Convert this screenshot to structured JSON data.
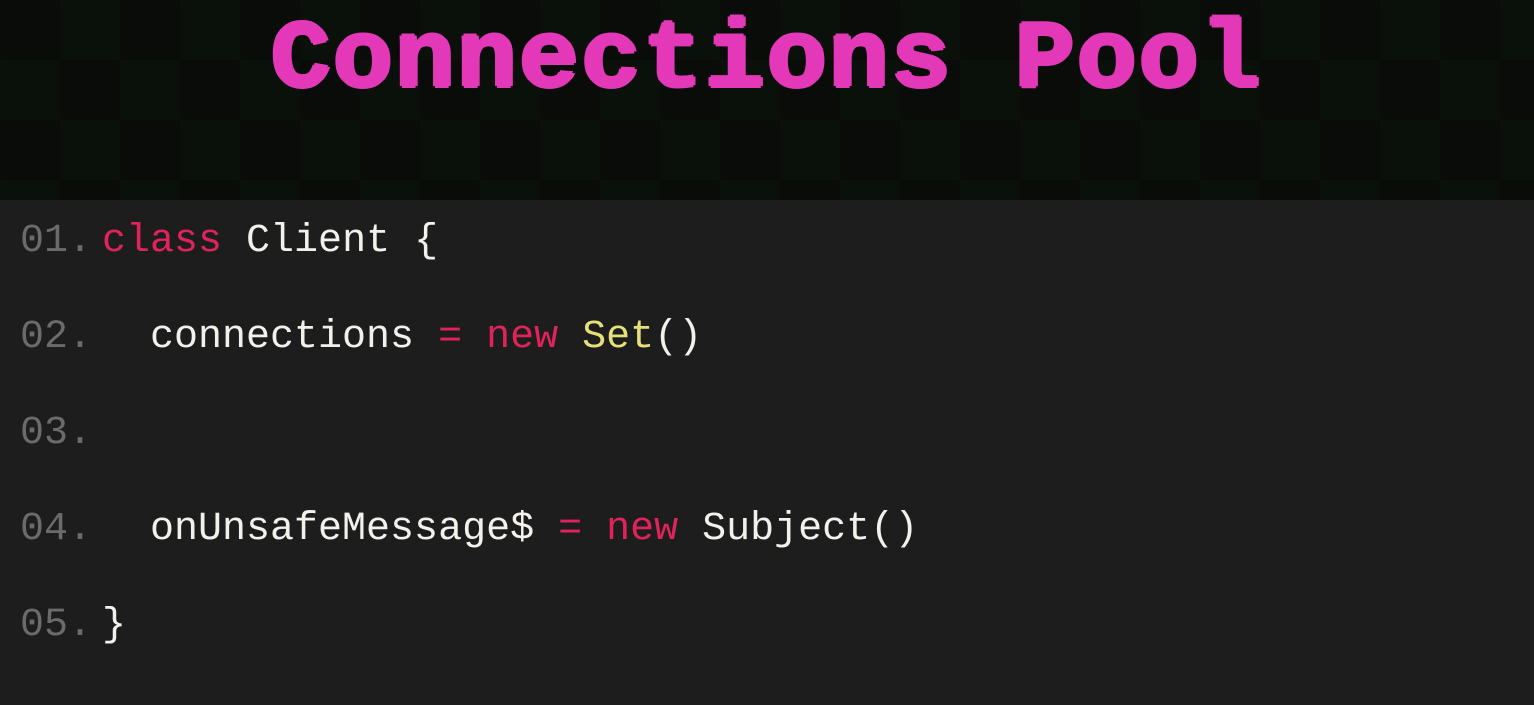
{
  "title": "Connections Pool",
  "colors": {
    "title": "#e339b8",
    "keyword": "#e0245b",
    "type": "#e7e07a",
    "text": "#f2f1ec",
    "line_number": "#6b6b6b",
    "panel_bg": "#1d1d1d",
    "page_bg": "#0a0d0a"
  },
  "code": {
    "lines": [
      {
        "n": "01.",
        "indent": 0,
        "tokens": [
          {
            "t": "class",
            "k": "keyword"
          },
          {
            "t": " ",
            "k": "plain"
          },
          {
            "t": "Client",
            "k": "ident"
          },
          {
            "t": " ",
            "k": "plain"
          },
          {
            "t": "{",
            "k": "punct"
          }
        ]
      },
      {
        "n": "02.",
        "indent": 1,
        "tokens": [
          {
            "t": "connections",
            "k": "ident"
          },
          {
            "t": " ",
            "k": "plain"
          },
          {
            "t": "=",
            "k": "op"
          },
          {
            "t": " ",
            "k": "plain"
          },
          {
            "t": "new",
            "k": "keyword"
          },
          {
            "t": " ",
            "k": "plain"
          },
          {
            "t": "Set",
            "k": "type"
          },
          {
            "t": "()",
            "k": "punct"
          }
        ]
      },
      {
        "n": "03.",
        "indent": 0,
        "tokens": []
      },
      {
        "n": "04.",
        "indent": 1,
        "tokens": [
          {
            "t": "onUnsafeMessage$",
            "k": "ident"
          },
          {
            "t": " ",
            "k": "plain"
          },
          {
            "t": "=",
            "k": "op"
          },
          {
            "t": " ",
            "k": "plain"
          },
          {
            "t": "new",
            "k": "keyword"
          },
          {
            "t": " ",
            "k": "plain"
          },
          {
            "t": "Subject",
            "k": "ident"
          },
          {
            "t": "()",
            "k": "punct"
          }
        ]
      },
      {
        "n": "05.",
        "indent": 0,
        "tokens": [
          {
            "t": "}",
            "k": "punct"
          }
        ]
      }
    ]
  }
}
